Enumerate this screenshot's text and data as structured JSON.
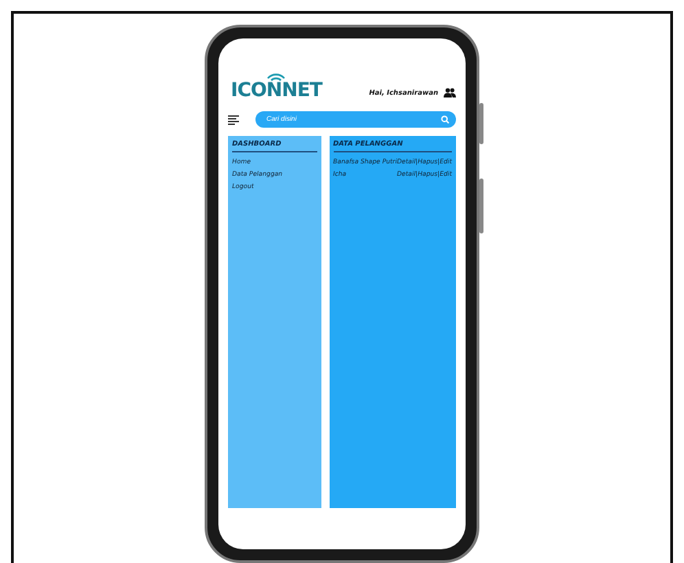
{
  "logo": {
    "text": "ICONNET"
  },
  "greeting": "Hai, Ichsanirawan",
  "search": {
    "placeholder": "Cari disini"
  },
  "sidebar": {
    "title": "DASHBOARD",
    "items": [
      "Home",
      "Data Pelanggan",
      "Logout"
    ]
  },
  "customers": {
    "title": "DATA PELANGGAN",
    "rows": [
      {
        "name": "Banafsa Shape Putri",
        "actions": "Detail|Hapus|Edit"
      },
      {
        "name": "Icha",
        "actions": "Detail|Hapus|Edit"
      }
    ]
  }
}
